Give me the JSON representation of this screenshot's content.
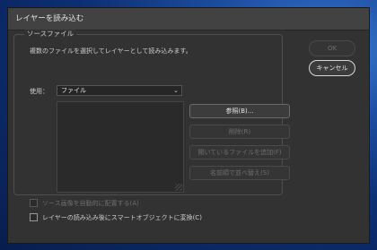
{
  "window": {
    "title": "レイヤーを読み込む"
  },
  "source": {
    "group_label": "ソースファイル",
    "description": "複数のファイルを選択してレイヤーとして読み込みます。",
    "use_label": "使用：",
    "use_value": "ファイル"
  },
  "buttons": {
    "browse": "参照(B)...",
    "remove": "削除(R)",
    "add_open": "開いているファイルを追加(F)",
    "sort": "名前順で並べ替え(S)",
    "ok": "OK",
    "cancel": "キャンセル"
  },
  "options": {
    "auto_align": "ソース画像を自動的に配置する(A)",
    "smart_object": "レイヤーの読み込み後にスマートオブジェクトに変換(C)"
  }
}
